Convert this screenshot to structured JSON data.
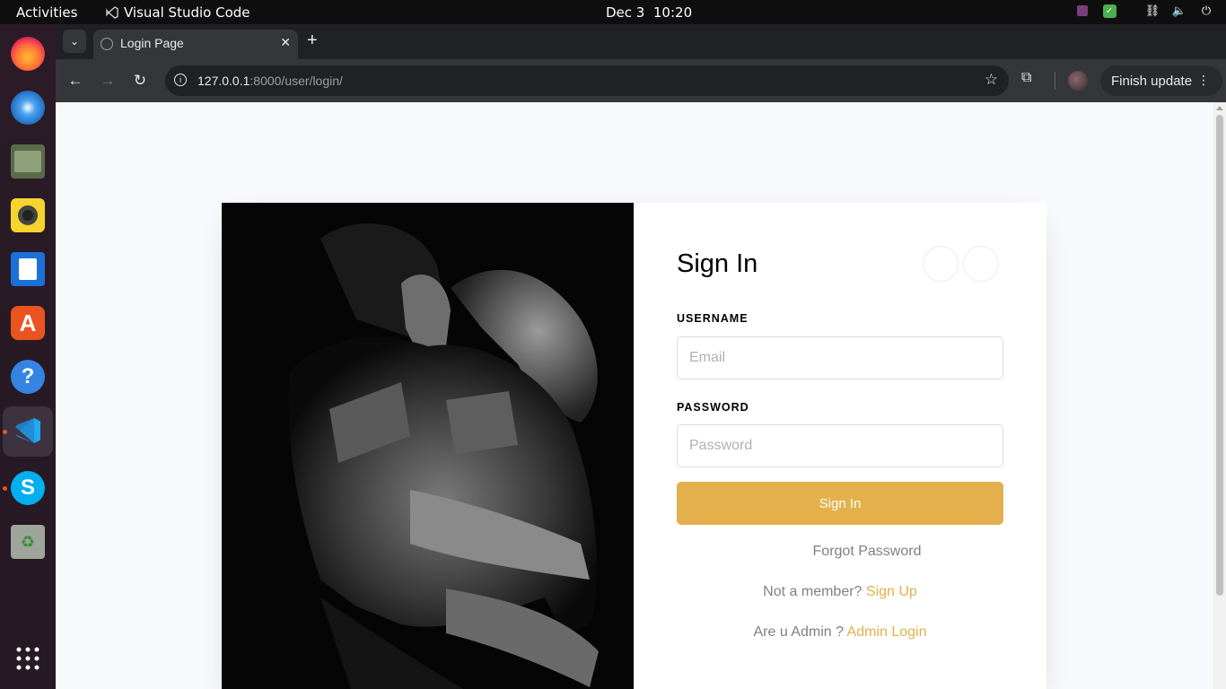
{
  "system": {
    "activities": "Activities",
    "app_name": "Visual Studio Code",
    "date": "Dec 3",
    "time": "10:20"
  },
  "dock": {
    "items": [
      "firefox-icon",
      "thunderbird-icon",
      "files-icon",
      "rhythmbox-icon",
      "writer-icon",
      "app-center-icon",
      "help-icon",
      "vscode-icon",
      "skype-icon",
      "trash-icon",
      "app-grid-icon"
    ]
  },
  "browser": {
    "tab_title": "Login Page",
    "url_host": "127.0.0.1",
    "url_path": ":8000/user/login/",
    "update_label": "Finish update"
  },
  "login": {
    "title": "Sign In",
    "username_label": "USERNAME",
    "username_placeholder": "Email",
    "password_label": "PASSWORD",
    "password_placeholder": "Password",
    "submit_label": "Sign In",
    "forgot_label": "Forgot Password",
    "member_prompt": "Not a member?",
    "signup_label": "Sign Up",
    "admin_prompt": "Are u Admin ?",
    "admin_label": "Admin Login"
  },
  "colors": {
    "accent": "#e3b04b",
    "page_bg": "#f8f9fd"
  }
}
